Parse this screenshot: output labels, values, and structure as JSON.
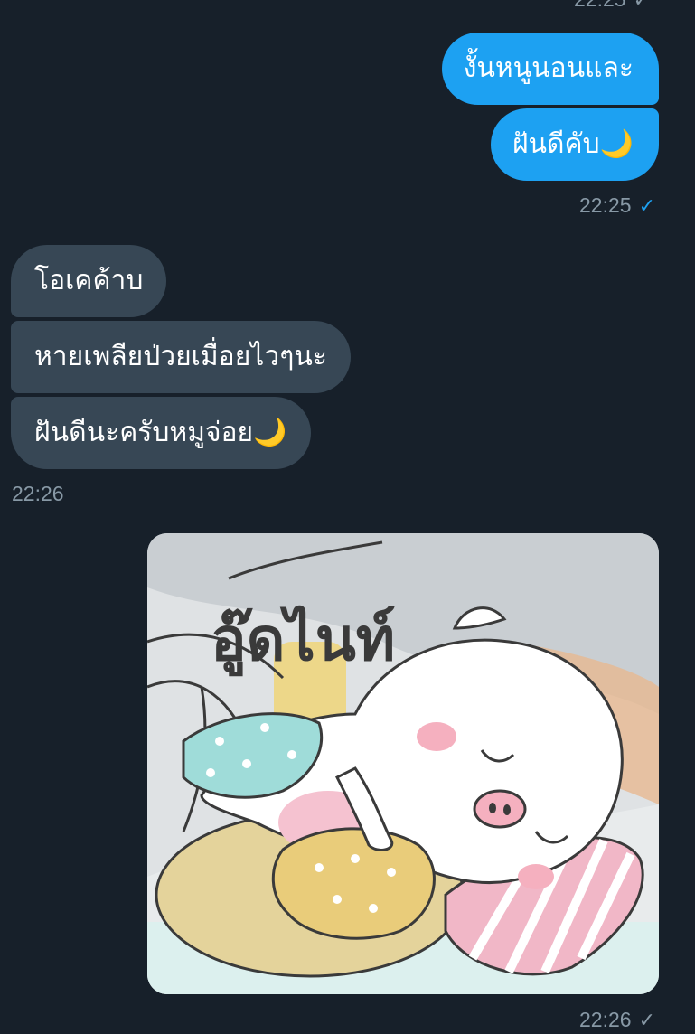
{
  "conversation": {
    "top_partial_time": "22:25",
    "outgoing_1": {
      "messages": [
        "งั้นหนูนอนและ",
        "ฝันดีคับ🌙"
      ],
      "time": "22:25"
    },
    "incoming_1": {
      "messages": [
        "โอเคค้าบ",
        "หายเพลียป่วยเมื่อยไวๆนะ",
        "ฝันดีนะครับหมูจ่อย🌙"
      ],
      "time": "22:26"
    },
    "outgoing_sticker": {
      "sticker_text": "อู๊ดไนท์",
      "time": "22:26"
    }
  },
  "colors": {
    "background": "#17202a",
    "outgoing_bubble": "#1da1f2",
    "incoming_bubble": "#374755",
    "timestamp": "#8899a6",
    "read_check": "#1da1f2"
  },
  "icons": {
    "sent_read": "check-icon-blue",
    "sent": "check-icon-grey"
  }
}
